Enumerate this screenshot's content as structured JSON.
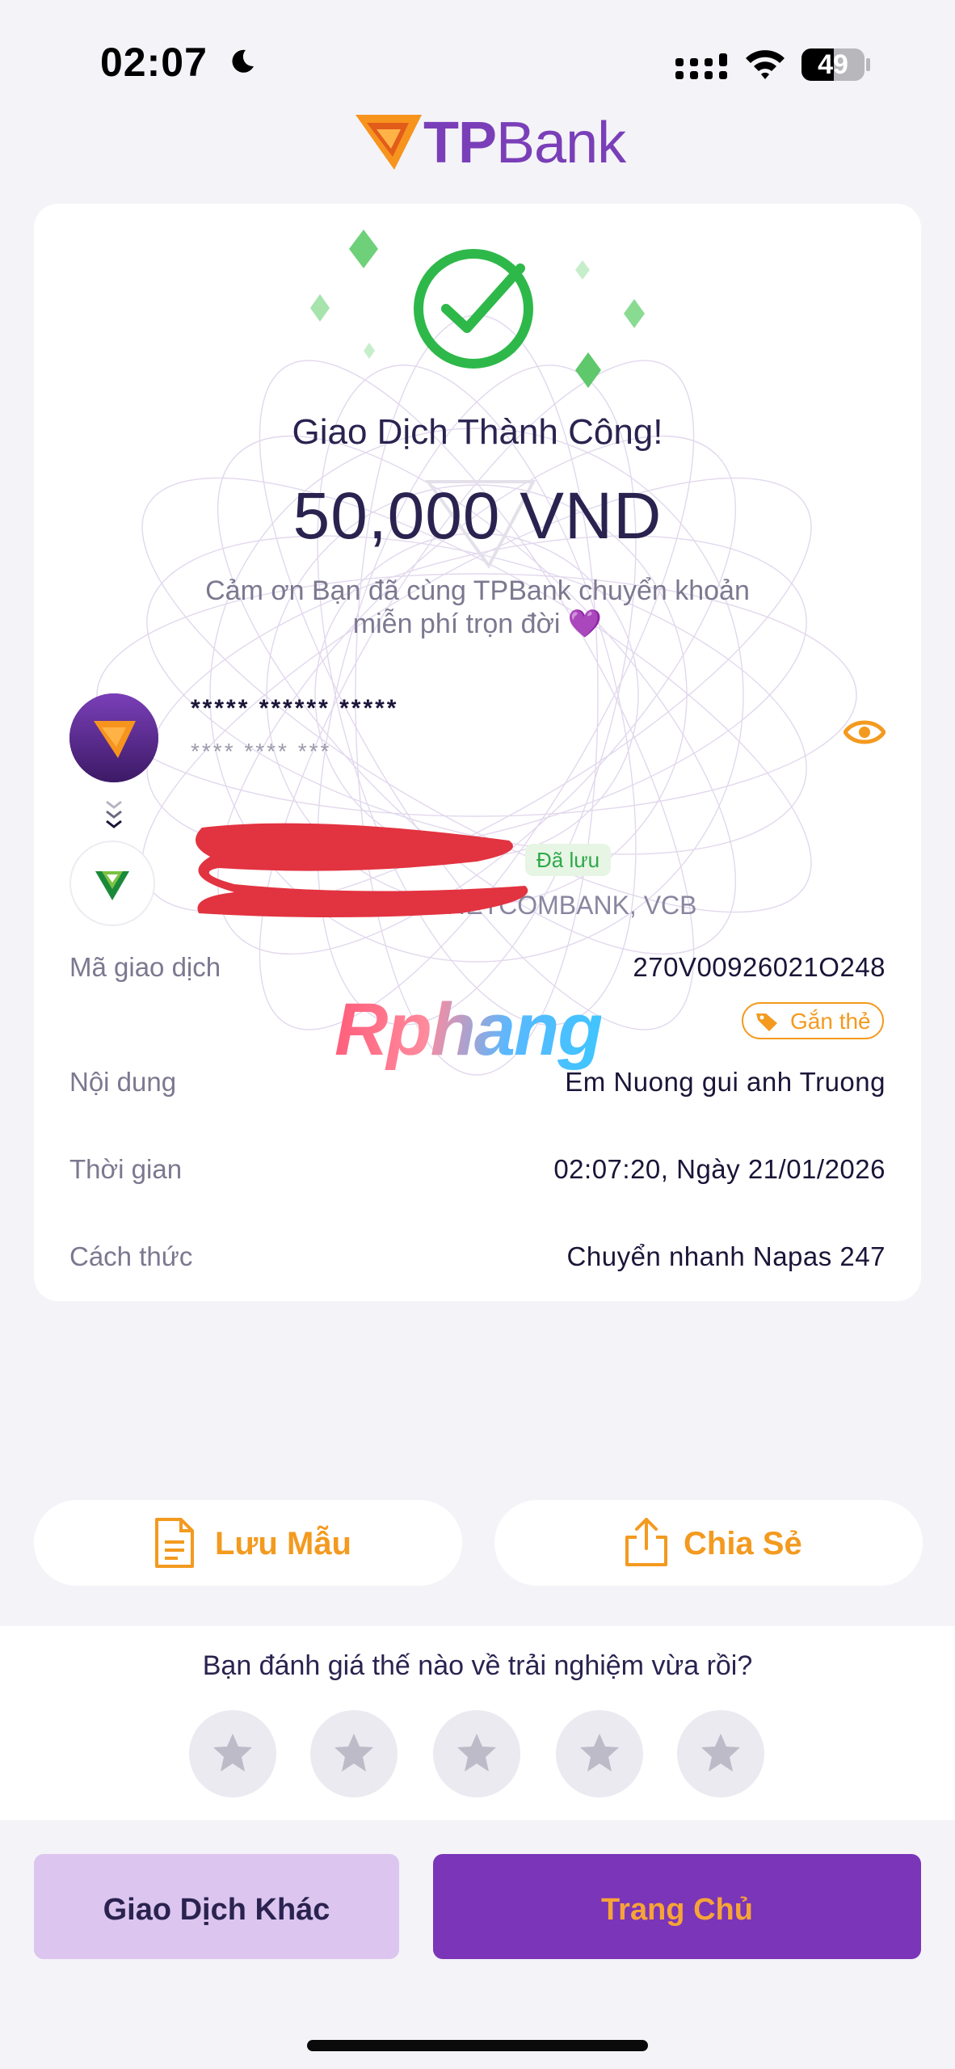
{
  "status_bar": {
    "time": "02:07",
    "battery_level": "49"
  },
  "brand": {
    "name_bold": "TP",
    "name_regular": "Bank"
  },
  "receipt": {
    "title": "Giao Dịch Thành Công!",
    "amount": "50,000 VND",
    "thanks_line_1": "Cảm ơn Bạn đã cùng TPBank chuyển khoản",
    "thanks_line_2": "miễn phí trọn đời 💜",
    "sender": {
      "name": "***** ****** *****",
      "account": "**** **** ***"
    },
    "receiver": {
      "bank": "VIETCOMBANK, VCB",
      "saved_badge": "Đã lưu"
    },
    "rows": {
      "txn_id": {
        "label": "Mã giao dịch",
        "value": "270V00926021O248"
      },
      "tag_card": "Gắn thẻ",
      "content": {
        "label": "Nội dung",
        "value": "Em Nuong gui anh Truong"
      },
      "time": {
        "label": "Thời gian",
        "value": "02:07:20, Ngày 21/01/2026"
      },
      "method": {
        "label": "Cách thức",
        "value": "Chuyển nhanh Napas 247"
      }
    },
    "watermark": "Rphang"
  },
  "actions": {
    "save_template": "Lưu Mẫu",
    "share": "Chia Sẻ"
  },
  "rating": {
    "question": "Bạn đánh giá thế nào về trải nghiệm vừa rồi?",
    "stars": 0,
    "max_stars": 5
  },
  "footer": {
    "other_transaction": "Giao Dịch Khác",
    "home": "Trang Chủ"
  },
  "colors": {
    "brand_purple": "#7b35b8",
    "accent_orange": "#f39a1f",
    "success_green": "#2eb84a"
  }
}
